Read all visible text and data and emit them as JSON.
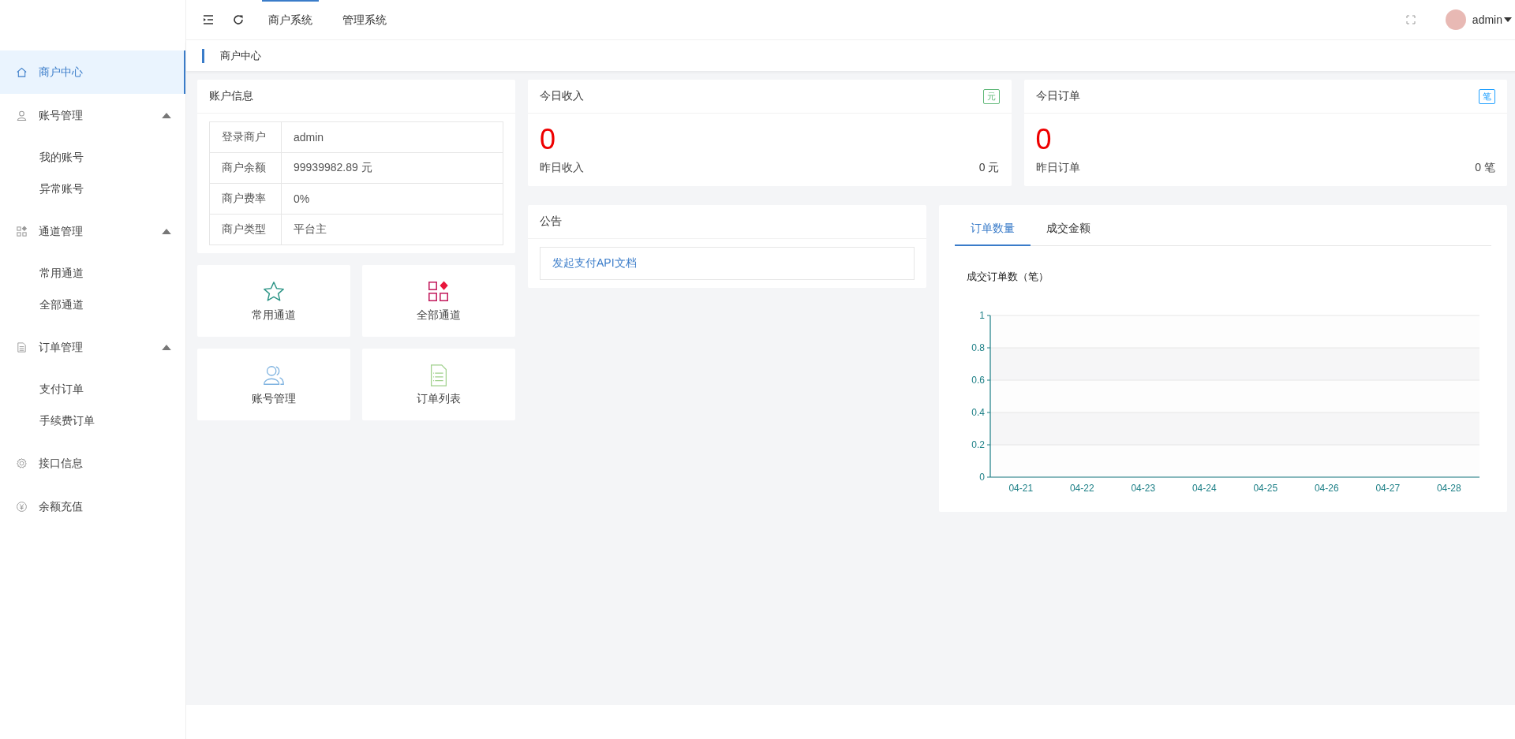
{
  "topbar": {
    "nav": [
      {
        "label": "商户系统",
        "selected": true
      },
      {
        "label": "管理系统",
        "selected": false
      }
    ],
    "user": "admin"
  },
  "sidebar": {
    "items": [
      {
        "label": "商户中心",
        "selected": true
      },
      {
        "label": "账号管理",
        "selected": false,
        "expanded": true,
        "children": [
          {
            "label": "我的账号",
            "selected": false
          },
          {
            "label": "异常账号",
            "selected": false
          }
        ]
      },
      {
        "label": "通道管理",
        "selected": false,
        "expanded": true,
        "children": [
          {
            "label": "常用通道",
            "selected": false
          },
          {
            "label": "全部通道",
            "selected": false
          }
        ]
      },
      {
        "label": "订单管理",
        "selected": false,
        "expanded": true,
        "children": [
          {
            "label": "支付订单",
            "selected": false
          },
          {
            "label": "手续费订单",
            "selected": false
          }
        ]
      },
      {
        "label": "接口信息",
        "selected": false
      },
      {
        "label": "余额充值",
        "selected": false
      }
    ]
  },
  "breadcrumb": "商户中心",
  "account": {
    "title": "账户信息",
    "rows": [
      {
        "label": "登录商户",
        "value": "admin"
      },
      {
        "label": "商户余额",
        "value": "99939982.89 元"
      },
      {
        "label": "商户费率",
        "value": "0%"
      },
      {
        "label": "商户类型",
        "value": "平台主"
      }
    ]
  },
  "shortcuts": [
    {
      "label": "常用通道"
    },
    {
      "label": "全部通道"
    },
    {
      "label": "账号管理"
    },
    {
      "label": "订单列表"
    }
  ],
  "stats": [
    {
      "title": "今日收入",
      "badge": "元",
      "color": "#5fb878",
      "value": "0",
      "sub_label": "昨日收入",
      "sub_value": "0 元"
    },
    {
      "title": "今日订单",
      "badge": "笔",
      "color": "#1e9fff",
      "value": "0",
      "sub_label": "昨日订单",
      "sub_value": "0 笔"
    }
  ],
  "notice": {
    "title": "公告",
    "link": "发起支付API文档"
  },
  "chart_tabs": [
    {
      "label": "订单数量",
      "selected": true
    },
    {
      "label": "成交金额",
      "selected": false
    }
  ],
  "chart_data": {
    "type": "line",
    "title": "成交订单数（笔）",
    "categories": [
      "04-21",
      "04-22",
      "04-23",
      "04-24",
      "04-25",
      "04-26",
      "04-27",
      "04-28"
    ],
    "grid": true,
    "ylim": [
      0,
      1
    ],
    "yticks": [
      0,
      0.2,
      0.4,
      0.6,
      0.8,
      1
    ]
  }
}
